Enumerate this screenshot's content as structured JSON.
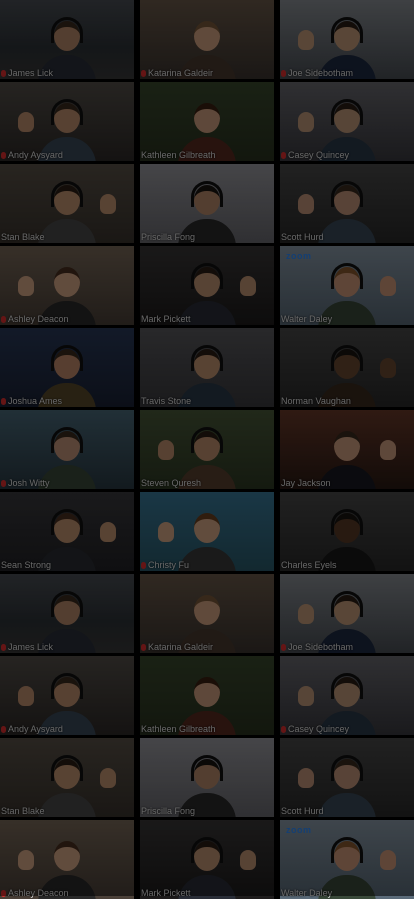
{
  "gallery": {
    "participants": [
      {
        "name": "James Lick",
        "muted": true
      },
      {
        "name": "Katarina Galdeir",
        "muted": true
      },
      {
        "name": "Joe Sidebotham",
        "muted": true
      },
      {
        "name": "Andy Aysyard",
        "muted": true
      },
      {
        "name": "Kathleen Gilbreath",
        "muted": false
      },
      {
        "name": "Casey Quincey",
        "muted": true
      },
      {
        "name": "Stan Blake",
        "muted": false
      },
      {
        "name": "Priscilla Fong",
        "muted": false
      },
      {
        "name": "Scott Hurd",
        "muted": false
      },
      {
        "name": "Ashley Deacon",
        "muted": true
      },
      {
        "name": "Mark Pickett",
        "muted": false
      },
      {
        "name": "Walter Daley",
        "muted": false
      },
      {
        "name": "Joshua Ames",
        "muted": true
      },
      {
        "name": "Travis Stone",
        "muted": false
      },
      {
        "name": "Norman Vaughan",
        "muted": false
      },
      {
        "name": "Josh Witty",
        "muted": true
      },
      {
        "name": "Steven Quresh",
        "muted": false
      },
      {
        "name": "Jay Jackson",
        "muted": false
      },
      {
        "name": "Sean Strong",
        "muted": false
      },
      {
        "name": "Christy Fu",
        "muted": true
      },
      {
        "name": "Charles Eyels",
        "muted": false
      },
      {
        "name": "James Lick",
        "muted": true
      },
      {
        "name": "Katarina Galdeir",
        "muted": true
      },
      {
        "name": "Joe Sidebotham",
        "muted": true
      },
      {
        "name": "Andy Aysyard",
        "muted": true
      },
      {
        "name": "Kathleen Gilbreath",
        "muted": false
      },
      {
        "name": "Casey Quincey",
        "muted": true
      },
      {
        "name": "Stan Blake",
        "muted": false
      },
      {
        "name": "Priscilla Fong",
        "muted": false
      },
      {
        "name": "Scott Hurd",
        "muted": false
      },
      {
        "name": "Ashley Deacon",
        "muted": true
      },
      {
        "name": "Mark Pickett",
        "muted": false
      },
      {
        "name": "Walter Daley",
        "muted": false
      }
    ]
  },
  "branding": {
    "zoom_label": "zoom"
  },
  "colors": {
    "mic_muted": "#e03030",
    "zoom_blue": "#2d8cff"
  }
}
